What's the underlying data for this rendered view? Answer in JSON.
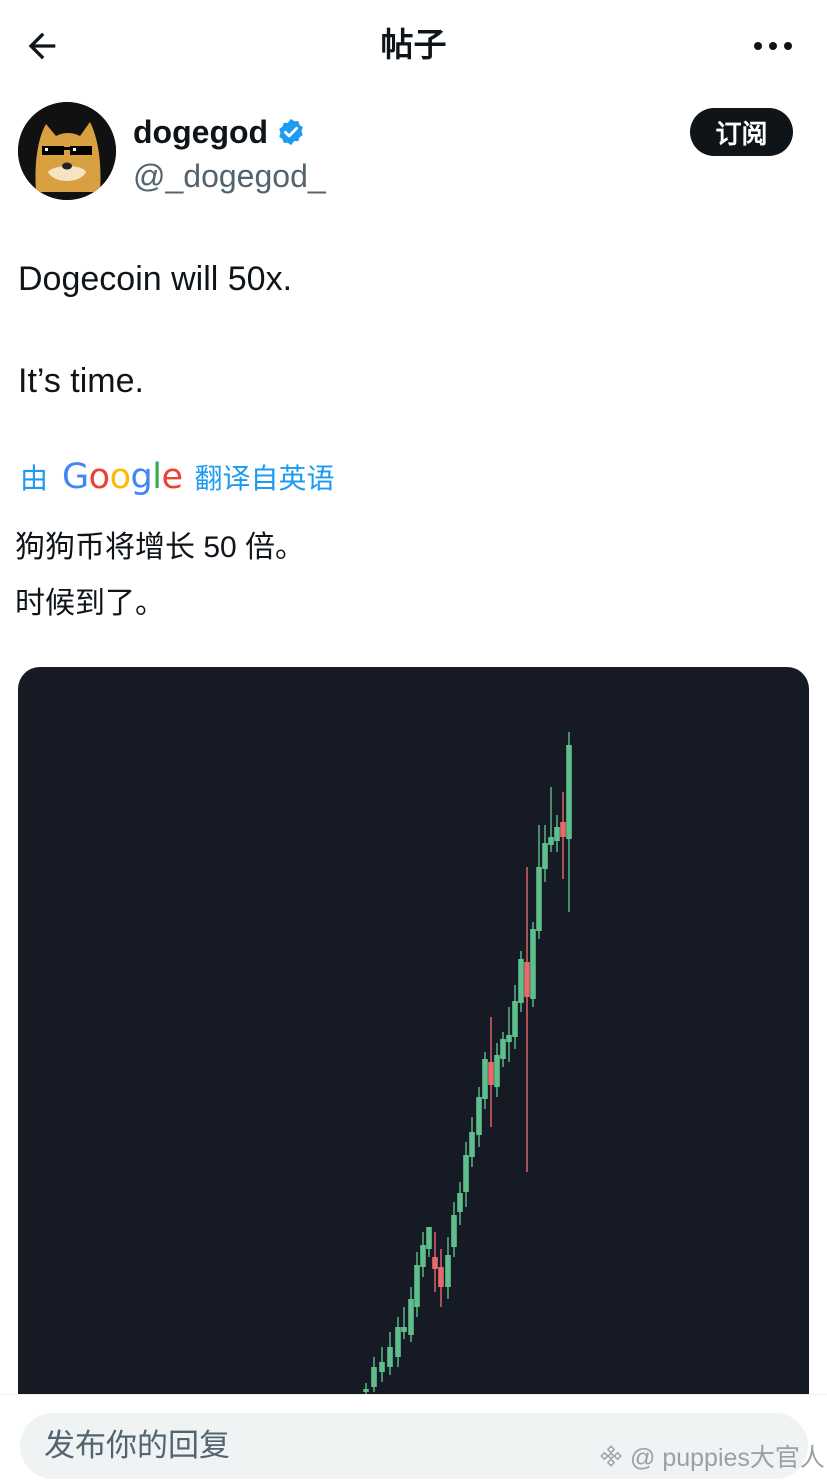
{
  "header": {
    "title": "帖子",
    "back_icon": "arrow-left-icon",
    "more_icon": "more-horizontal-icon"
  },
  "author": {
    "display_name": "dogegod",
    "handle": "@_dogegod_",
    "verified": true,
    "verified_color": "#1d9bf0"
  },
  "subscribe_label": "订阅",
  "tweet": {
    "lines": [
      "Dogecoin will 50x.",
      "It’s time."
    ]
  },
  "translation": {
    "prefix": "由",
    "provider": "Google",
    "suffix": "翻译自英语",
    "lines": [
      "狗狗币将增长 50 倍。",
      "时候到了。"
    ]
  },
  "media": {
    "background": "#161a25",
    "up_color": "#5fbf8c",
    "down_color": "#e36b6b"
  },
  "reply": {
    "placeholder": "发布你的回复"
  },
  "watermark": {
    "text": "@ puppies大官人"
  },
  "colors": {
    "accent": "#1d9bf0",
    "text": "#0f1419",
    "secondary": "#536471"
  }
}
